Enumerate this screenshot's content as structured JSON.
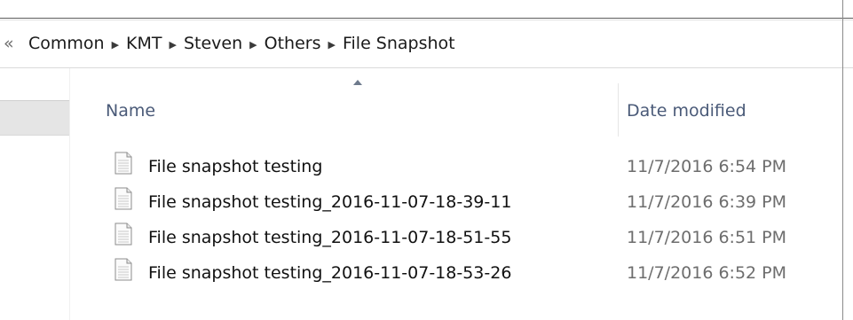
{
  "address_bar": {
    "overflow": "«",
    "crumbs": [
      "Common",
      "KMT",
      "Steven",
      "Others",
      "File Snapshot"
    ],
    "separator": "▶"
  },
  "columns": {
    "name": "Name",
    "date_modified": "Date modified"
  },
  "files": [
    {
      "name": "File snapshot testing",
      "date": "11/7/2016 6:54 PM"
    },
    {
      "name": "File snapshot testing_2016-11-07-18-39-11",
      "date": "11/7/2016 6:39 PM"
    },
    {
      "name": "File snapshot testing_2016-11-07-18-51-55",
      "date": "11/7/2016 6:51 PM"
    },
    {
      "name": "File snapshot testing_2016-11-07-18-53-26",
      "date": "11/7/2016 6:52 PM"
    }
  ],
  "colors": {
    "header_text": "#4a5a78",
    "date_text": "#6d6d6d"
  },
  "icons": {
    "file": "text-document-icon",
    "sort": "sort-ascending-icon"
  }
}
